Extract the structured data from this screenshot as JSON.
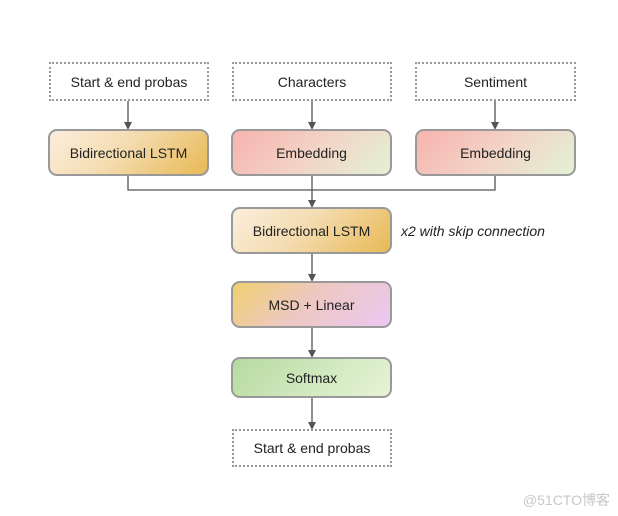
{
  "diagram": {
    "inputs": [
      {
        "id": "input-start-end",
        "label": "Start & end probas"
      },
      {
        "id": "input-characters",
        "label": "Characters"
      },
      {
        "id": "input-sentiment",
        "label": "Sentiment"
      }
    ],
    "first_layer": [
      {
        "id": "bilstm-top",
        "label": "Bidirectional LSTM"
      },
      {
        "id": "embedding-characters",
        "label": "Embedding"
      },
      {
        "id": "embedding-sentiment",
        "label": "Embedding"
      }
    ],
    "stack": [
      {
        "id": "bilstm-main",
        "label": "Bidirectional LSTM"
      },
      {
        "id": "msd-linear",
        "label": "MSD + Linear"
      },
      {
        "id": "softmax",
        "label": "Softmax"
      }
    ],
    "stack_note": "x2 with skip connection",
    "output": {
      "id": "output-start-end",
      "label": "Start & end probas"
    },
    "colors": {
      "border": "#999999",
      "connector": "#555555"
    }
  },
  "watermark": "@51CTO博客"
}
